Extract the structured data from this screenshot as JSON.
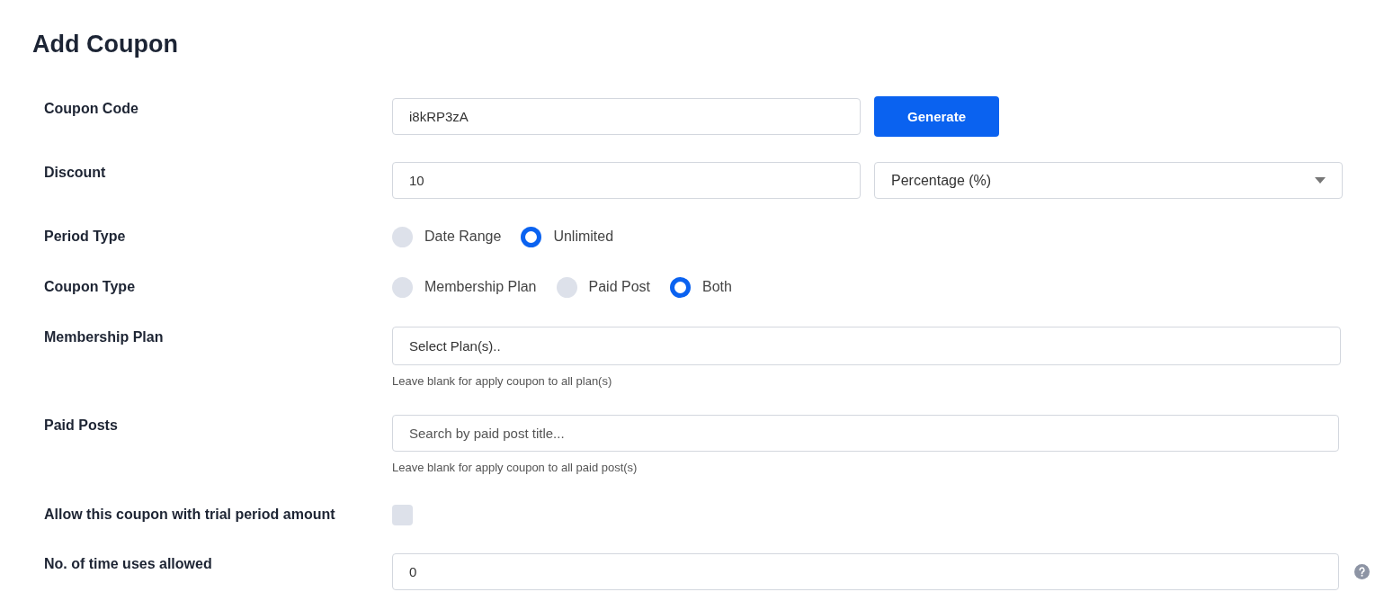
{
  "title": "Add Coupon",
  "fields": [
    {
      "label": "Coupon Code",
      "kind": "text_with_button",
      "value": "i8kRP3zA",
      "button": "Generate"
    },
    {
      "label": "Discount",
      "kind": "text_with_select",
      "value": "10",
      "select": "Percentage (%)"
    },
    {
      "label": "Period Type",
      "kind": "radio",
      "options": [
        {
          "label": "Date Range",
          "selected": false
        },
        {
          "label": "Unlimited",
          "selected": true
        }
      ]
    },
    {
      "label": "Coupon Type",
      "kind": "radio",
      "options": [
        {
          "label": "Membership Plan",
          "selected": false
        },
        {
          "label": "Paid Post",
          "selected": false
        },
        {
          "label": "Both",
          "selected": true
        }
      ]
    },
    {
      "label": "Membership Plan",
      "kind": "multiselect",
      "value": "Select Plan(s)..",
      "hint": "Leave blank for apply coupon to all plan(s)"
    },
    {
      "label": "Paid Posts",
      "kind": "search",
      "placeholder": "Search by paid post title...",
      "hint": "Leave blank for apply coupon to all paid post(s)"
    },
    {
      "label": "Allow this coupon with trial period amount",
      "kind": "checkbox",
      "checked": false
    },
    {
      "label": "No. of time uses allowed",
      "kind": "number",
      "value": "0",
      "help": true
    }
  ]
}
